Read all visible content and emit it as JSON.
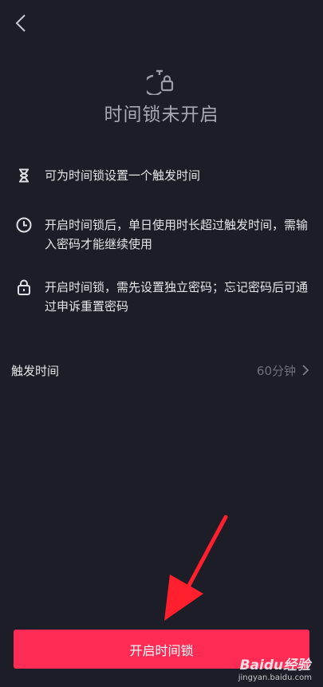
{
  "header": {
    "back_icon": "chevron-left-icon",
    "hero_icon": "timer-lock-icon",
    "title": "时间锁未开启"
  },
  "features": [
    {
      "icon": "hourglass-icon",
      "text": "可为时间锁设置一个触发时间"
    },
    {
      "icon": "clock-icon",
      "text": "开启时间锁后，单日使用时长超过触发时间，需输入密码才能继续使用"
    },
    {
      "icon": "lock-icon",
      "text": "开启时间锁，需先设置独立密码；忘记密码后可通过申诉重置密码"
    }
  ],
  "trigger_row": {
    "label": "触发时间",
    "value": "60分钟",
    "icon": "chevron-right-icon"
  },
  "primary_button": {
    "label": "开启时间锁"
  },
  "watermark": {
    "brand": "Baidu经验",
    "url": "jingyan.baidu.com"
  },
  "colors": {
    "background": "#1c1d26",
    "accent": "#fe2c55",
    "text_primary": "#e6e6e9",
    "text_secondary": "#a8a9b0",
    "text_muted": "#6e6f78",
    "annotation_arrow": "#ff1f2d"
  }
}
